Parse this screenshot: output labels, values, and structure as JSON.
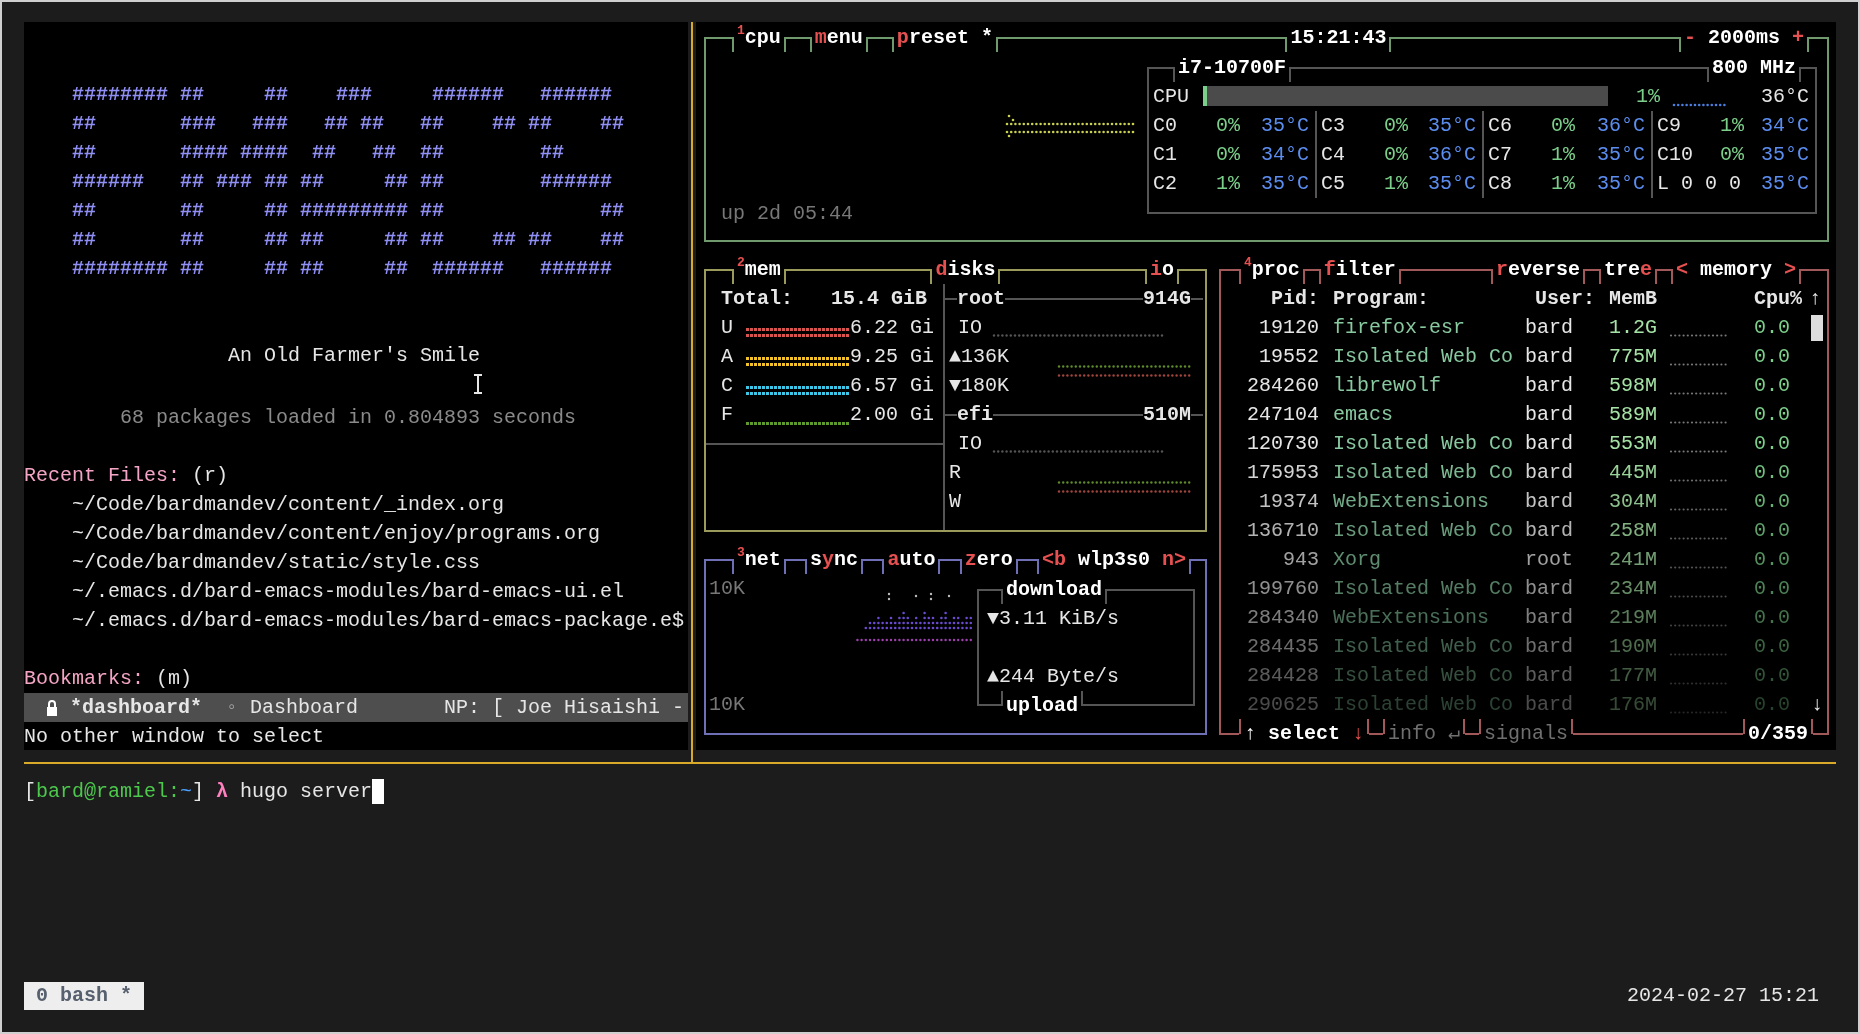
{
  "emacs": {
    "banner": [
      "######## ##     ##    ###     ######   ######",
      "##       ###   ###   ## ##   ##    ## ##    ##",
      "##       #### ####  ##   ##  ##        ##",
      "######   ## ### ## ##     ## ##        ######",
      "##       ##     ## ######### ##             ##",
      "##       ##     ## ##     ## ##    ## ##    ##",
      "######## ##     ## ##     ##  ######   ######"
    ],
    "title": "An Old Farmer's Smile",
    "load_message": "68 packages loaded in 0.804893 seconds",
    "recent_files": {
      "heading": "Recent Files:",
      "key": "(r)",
      "items": [
        "~/Code/bardmandev/content/_index.org",
        "~/Code/bardmandev/content/enjoy/programs.org",
        "~/Code/bardmandev/static/style.css",
        "~/.emacs.d/bard-emacs-modules/bard-emacs-ui.el",
        "~/.emacs.d/bard-emacs-modules/bard-emacs-package.e$"
      ]
    },
    "bookmarks": {
      "heading": "Bookmarks:",
      "key": "(m)"
    },
    "mode_line": {
      "buffer": "*dashboard*",
      "indicator": "◦",
      "mode": "Dashboard",
      "now_playing": "NP: [ Joe Hisaishi -"
    },
    "echo": "No other window to select"
  },
  "cpu": {
    "tabs_left": [
      {
        "parts": [
          {
            "text": "$^{1}$",
            "hotkey": true
          },
          {
            "text": "cpu",
            "hotkey": false
          }
        ]
      },
      {
        "parts": [
          {
            "text": "m",
            "hotkey": true
          },
          {
            "text": "enu",
            "hotkey": false
          }
        ]
      },
      {
        "parts": [
          {
            "text": "p",
            "hotkey": true
          },
          {
            "text": "reset *",
            "hotkey": false
          }
        ]
      }
    ],
    "clock": "15:21:43",
    "tabs_right": [
      {
        "parts": [
          {
            "text": "-",
            "hotkey": true
          },
          {
            "text": " 2000ms ",
            "hotkey": false
          },
          {
            "text": "+",
            "hotkey": true
          }
        ]
      }
    ],
    "model": "i7-10700F",
    "frequency": "800 MHz",
    "total": {
      "label": "CPU",
      "level": 0.01,
      "percent": "1%",
      "temp": "36°C"
    },
    "core_groups": [
      [
        {
          "name": "C0",
          "percent": "0%",
          "temp": "35°C"
        },
        {
          "name": "C1",
          "percent": "0%",
          "temp": "34°C"
        },
        {
          "name": "C2",
          "percent": "1%",
          "temp": "35°C"
        }
      ],
      [
        {
          "name": "C3",
          "percent": "0%",
          "temp": "35°C"
        },
        {
          "name": "C4",
          "percent": "0%",
          "temp": "36°C"
        },
        {
          "name": "C5",
          "percent": "1%",
          "temp": "35°C"
        }
      ],
      [
        {
          "name": "C6",
          "percent": "0%",
          "temp": "36°C"
        },
        {
          "name": "C7",
          "percent": "1%",
          "temp": "35°C"
        },
        {
          "name": "C8",
          "percent": "1%",
          "temp": "35°C"
        }
      ],
      [
        {
          "name": "C9",
          "percent": "1%",
          "temp": "34°C"
        },
        {
          "name": "C10",
          "percent": "0%",
          "temp": "35°C"
        },
        {
          "name": "L 0 0 0",
          "temp": "35°C"
        }
      ]
    ],
    "uptime": "up 2d 05:44"
  },
  "mem": {
    "tabs": [
      {
        "parts": [
          {
            "text": "$^{2}$",
            "hotkey": true
          },
          {
            "text": "mem",
            "hotkey": false
          }
        ]
      },
      {
        "parts": [
          {
            "text": "d",
            "hotkey": true
          },
          {
            "text": "isks",
            "hotkey": false
          }
        ]
      },
      {
        "parts": [
          {
            "text": "i",
            "hotkey": true
          },
          {
            "text": "o",
            "hotkey": false
          }
        ]
      }
    ],
    "total_label": "Total:",
    "total": "15.4 GiB",
    "rows": [
      {
        "label": "U",
        "value": "6.22 Gi",
        "color": "#d9534f"
      },
      {
        "label": "A",
        "value": "9.25 Gi",
        "color": "#f2c12e"
      },
      {
        "label": "C",
        "value": "6.57 Gi",
        "color": "#3fc6e6"
      },
      {
        "label": "F",
        "value": "2.00 Gi",
        "color": "#5e9a2e"
      }
    ],
    "disks": [
      {
        "name": "root",
        "size": "914G",
        "rows": [
          {
            "label": "IO",
            "kind": "io"
          },
          {
            "label": "▲136K",
            "kind": "read"
          },
          {
            "label": "▼180K",
            "kind": "write"
          }
        ]
      },
      {
        "name": "efi",
        "size": "510M",
        "rows": [
          {
            "label": "IO",
            "kind": "io"
          },
          {
            "label": "R",
            "kind": "read"
          },
          {
            "label": "W",
            "kind": "write"
          }
        ]
      }
    ]
  },
  "net": {
    "tabs": [
      {
        "parts": [
          {
            "text": "$^{3}$",
            "hotkey": true
          },
          {
            "text": "net",
            "hotkey": false
          }
        ]
      },
      {
        "parts": [
          {
            "text": "s",
            "hotkey": false
          },
          {
            "text": "y",
            "hotkey": true
          },
          {
            "text": "nc",
            "hotkey": false
          }
        ]
      },
      {
        "parts": [
          {
            "text": "a",
            "hotkey": true
          },
          {
            "text": "uto",
            "hotkey": false
          }
        ]
      },
      {
        "parts": [
          {
            "text": "z",
            "hotkey": true
          },
          {
            "text": "ero",
            "hotkey": false
          }
        ]
      },
      {
        "parts": [
          {
            "text": "<b",
            "hotkey": true
          },
          {
            "text": " wlp3s0 ",
            "hotkey": false
          },
          {
            "text": "n>",
            "hotkey": true
          }
        ]
      }
    ],
    "scale_top": "10K",
    "scale_bottom": "10K",
    "download": {
      "title": "download",
      "rate": "▼3.11 KiB/s"
    },
    "upload": {
      "rate": "▲244 Byte/s",
      "title": "upload"
    }
  },
  "proc": {
    "tabs_left": [
      {
        "parts": [
          {
            "text": "$^{4}$",
            "hotkey": true
          },
          {
            "text": "proc",
            "hotkey": false
          }
        ]
      },
      {
        "parts": [
          {
            "text": "f",
            "hotkey": true
          },
          {
            "text": "ilter",
            "hotkey": false
          }
        ]
      }
    ],
    "tabs_right": [
      {
        "parts": [
          {
            "text": "r",
            "hotkey": true
          },
          {
            "text": "everse",
            "hotkey": false
          }
        ]
      },
      {
        "parts": [
          {
            "text": "tre",
            "hotkey": false
          },
          {
            "text": "e",
            "hotkey": true
          }
        ]
      },
      {
        "parts": [
          {
            "text": "<",
            "hotkey": true
          },
          {
            "text": " memory ",
            "hotkey": false
          },
          {
            "text": ">",
            "hotkey": true
          }
        ]
      }
    ],
    "columns": [
      "Pid:",
      "Program:",
      "User:",
      "MemB",
      "Cpu%"
    ],
    "scroll_up": "↑",
    "scroll_down": "↓",
    "rows": [
      {
        "pid": "19120",
        "program": "firefox-esr",
        "user": "bard",
        "mem": "1.2G",
        "cpu": "0.0"
      },
      {
        "pid": "19552",
        "program": "Isolated Web Co",
        "user": "bard",
        "mem": "775M",
        "cpu": "0.0"
      },
      {
        "pid": "284260",
        "program": "librewolf",
        "user": "bard",
        "mem": "598M",
        "cpu": "0.0"
      },
      {
        "pid": "247104",
        "program": "emacs",
        "user": "bard",
        "mem": "589M",
        "cpu": "0.0"
      },
      {
        "pid": "120730",
        "program": "Isolated Web Co",
        "user": "bard",
        "mem": "553M",
        "cpu": "0.0"
      },
      {
        "pid": "175953",
        "program": "Isolated Web Co",
        "user": "bard",
        "mem": "445M",
        "cpu": "0.0"
      },
      {
        "pid": "19374",
        "program": "WebExtensions",
        "user": "bard",
        "mem": "304M",
        "cpu": "0.0"
      },
      {
        "pid": "136710",
        "program": "Isolated Web Co",
        "user": "bard",
        "mem": "258M",
        "cpu": "0.0"
      },
      {
        "pid": "943",
        "program": "Xorg",
        "user": "root",
        "mem": "241M",
        "cpu": "0.0"
      },
      {
        "pid": "199760",
        "program": "Isolated Web Co",
        "user": "bard",
        "mem": "234M",
        "cpu": "0.0"
      },
      {
        "pid": "284340",
        "program": "WebExtensions",
        "user": "bard",
        "mem": "219M",
        "cpu": "0.0"
      },
      {
        "pid": "284435",
        "program": "Isolated Web Co",
        "user": "bard",
        "mem": "190M",
        "cpu": "0.0"
      },
      {
        "pid": "284428",
        "program": "Isolated Web Co",
        "user": "bard",
        "mem": "177M",
        "cpu": "0.0"
      },
      {
        "pid": "290625",
        "program": "Isolated Web Co",
        "user": "bard",
        "mem": "176M",
        "cpu": "0.0"
      }
    ],
    "footer": [
      {
        "disabled": false,
        "parts": [
          {
            "text": "↑ ",
            "hotkey": false
          },
          {
            "text": "select ",
            "hotkey": false
          },
          {
            "text": "↓",
            "hotkey": true
          }
        ]
      },
      {
        "disabled": true,
        "parts": [
          {
            "text": "info ",
            "hotkey": false
          },
          {
            "text": "↵",
            "hotkey": false
          }
        ]
      },
      {
        "disabled": true,
        "parts": [
          {
            "text": "signals",
            "hotkey": false
          }
        ]
      }
    ],
    "count": "0/359"
  },
  "shell": {
    "prompt": [
      {
        "text": "[",
        "kind": "plain"
      },
      {
        "text": "bard@ramiel:",
        "kind": "user"
      },
      {
        "text": "~",
        "kind": "path"
      },
      {
        "text": "]",
        "kind": "plain"
      }
    ],
    "symbol": "λ",
    "command": "hugo server"
  },
  "tmux": {
    "window": "0 bash *",
    "clock": "2024-02-27 15:21"
  }
}
